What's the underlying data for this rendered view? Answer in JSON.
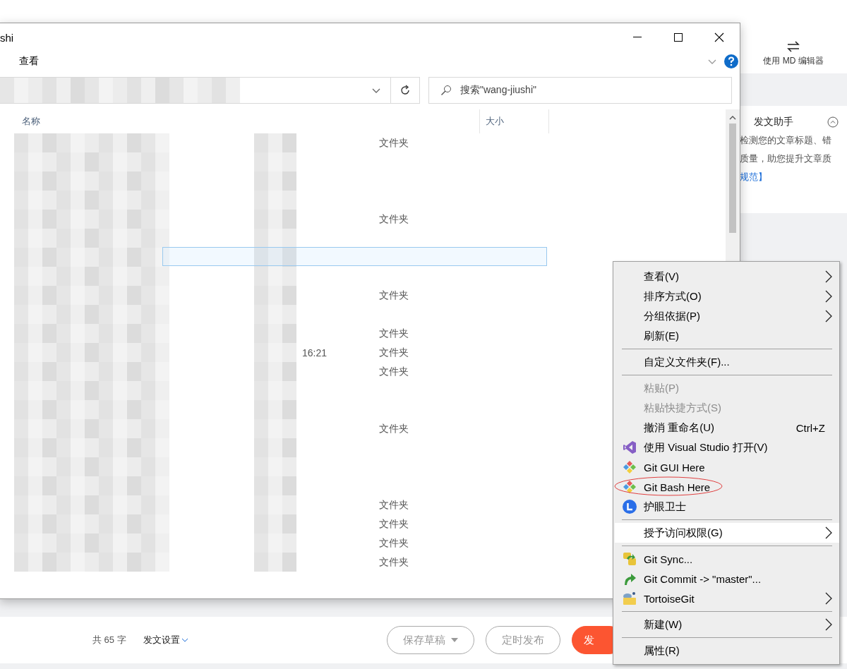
{
  "editor": {
    "md_toggle": "使用 MD 编辑器",
    "assistant": {
      "title": "发文助手",
      "lines": [
        "检测您的文章标题、错",
        "质量，助您提升文章质",
        "规范】"
      ]
    },
    "footer": {
      "word_count": "共 65 字",
      "settings": "发文设置",
      "buttons": [
        {
          "label": "保存草稿",
          "kind": "dropdown"
        },
        {
          "label": "定时发布",
          "kind": "outline"
        },
        {
          "label": "发",
          "kind": "primary"
        }
      ]
    }
  },
  "explorer": {
    "title": "shi",
    "ribbon_tab": "查看",
    "search": {
      "placeholder": "搜索\"wang-jiushi\""
    },
    "columns": [
      "名称",
      "大小"
    ],
    "rows": [
      {
        "type": "文件夹",
        "selected": false
      },
      {
        "selected": false
      },
      {
        "selected": false
      },
      {
        "selected": false
      },
      {
        "type": "文件夹",
        "selected": false
      },
      {
        "selected": false
      },
      {
        "selected": true
      },
      {
        "selected": false
      },
      {
        "type": "文件夹",
        "selected": false
      },
      {
        "selected": false
      },
      {
        "type": "文件夹",
        "selected": false
      },
      {
        "type": "文件夹",
        "time": "16:21",
        "selected": false
      },
      {
        "type": "文件夹",
        "selected": false
      },
      {
        "selected": false
      },
      {
        "selected": false
      },
      {
        "type": "文件夹",
        "selected": false
      },
      {
        "selected": false
      },
      {
        "selected": false
      },
      {
        "selected": false
      },
      {
        "type": "文件夹",
        "selected": false
      },
      {
        "type": "文件夹",
        "selected": false
      },
      {
        "type": "文件夹",
        "selected": false
      },
      {
        "type": "文件夹",
        "selected": false
      }
    ]
  },
  "context_menu": [
    {
      "kind": "item",
      "label": "查看(V)",
      "submenu": true,
      "disabled": false,
      "highlighted": false
    },
    {
      "kind": "item",
      "label": "排序方式(O)",
      "submenu": true,
      "disabled": false,
      "highlighted": false
    },
    {
      "kind": "item",
      "label": "分组依据(P)",
      "submenu": true,
      "disabled": false,
      "highlighted": false
    },
    {
      "kind": "item",
      "label": "刷新(E)",
      "submenu": false,
      "disabled": false,
      "highlighted": false
    },
    {
      "kind": "separator"
    },
    {
      "kind": "item",
      "label": "自定义文件夹(F)...",
      "submenu": false,
      "disabled": false,
      "highlighted": false
    },
    {
      "kind": "separator"
    },
    {
      "kind": "item",
      "label": "粘贴(P)",
      "submenu": false,
      "disabled": true,
      "highlighted": false
    },
    {
      "kind": "item",
      "label": "粘贴快捷方式(S)",
      "submenu": false,
      "disabled": true,
      "highlighted": false
    },
    {
      "kind": "item",
      "label": "撤消 重命名(U)",
      "shortcut": "Ctrl+Z",
      "submenu": false,
      "disabled": false,
      "highlighted": false
    },
    {
      "kind": "vs",
      "label": "使用 Visual Studio 打开(V)",
      "submenu": false,
      "disabled": false,
      "highlighted": false
    },
    {
      "kind": "git",
      "label": "Git GUI Here",
      "submenu": false,
      "disabled": false,
      "highlighted": false
    },
    {
      "kind": "git",
      "label": "Git Bash Here",
      "submenu": false,
      "disabled": false,
      "highlighted": false,
      "circled": true
    },
    {
      "kind": "eye",
      "label": "护眼卫士",
      "submenu": false,
      "disabled": false,
      "highlighted": false
    },
    {
      "kind": "separator"
    },
    {
      "kind": "item",
      "label": "授予访问权限(G)",
      "submenu": true,
      "disabled": false,
      "highlighted": true
    },
    {
      "kind": "separator"
    },
    {
      "kind": "sync",
      "label": "Git Sync...",
      "submenu": false,
      "disabled": false,
      "highlighted": false
    },
    {
      "kind": "commit",
      "label": "Git Commit -> \"master\"...",
      "submenu": false,
      "disabled": false,
      "highlighted": false
    },
    {
      "kind": "tortoise",
      "label": "TortoiseGit",
      "submenu": true,
      "disabled": false,
      "highlighted": false
    },
    {
      "kind": "separator"
    },
    {
      "kind": "item",
      "label": "新建(W)",
      "submenu": true,
      "disabled": false,
      "highlighted": false
    },
    {
      "kind": "separator"
    },
    {
      "kind": "item",
      "label": "属性(R)",
      "submenu": false,
      "disabled": false,
      "highlighted": false
    }
  ]
}
